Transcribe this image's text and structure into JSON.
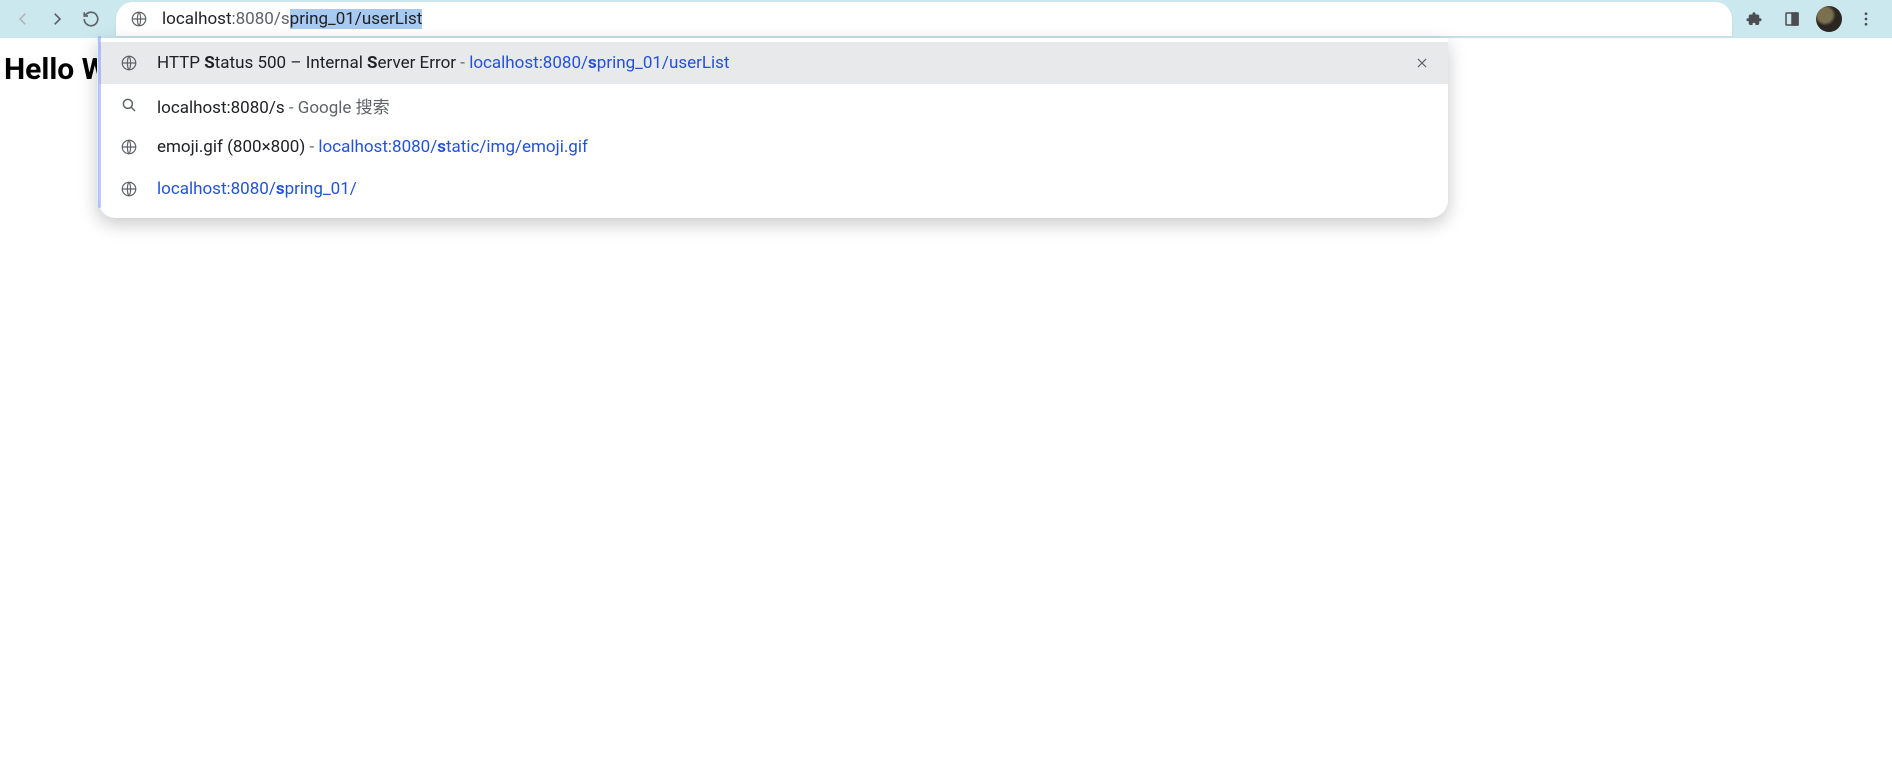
{
  "toolbar": {
    "url_host": "localhost",
    "url_port": ":8080",
    "url_typed": "/s",
    "url_completed": "pring_01/userList"
  },
  "page": {
    "heading_visible": "Hello W"
  },
  "suggestions": [
    {
      "icon": "globe",
      "title_pre": "HTTP ",
      "title_b1": "S",
      "title_mid1": "tatus 500 – Internal ",
      "title_b2": "S",
      "title_mid2": "erver Error",
      "sep": " - ",
      "url_pre": "localhost:8080/",
      "url_b": "s",
      "url_post": "pring_01/userList",
      "removable": true,
      "selected": true
    },
    {
      "icon": "search",
      "title_pre": "localhost:8080/s",
      "sep": " - ",
      "muted": "Google 搜索",
      "removable": false,
      "selected": false
    },
    {
      "icon": "globe",
      "title_pre": "emoji.gif (800×800)",
      "sep": " - ",
      "url_pre": "localhost:8080/",
      "url_b": "s",
      "url_post": "tatic/img/emoji.gif",
      "removable": false,
      "selected": false
    },
    {
      "icon": "globe",
      "url_pre": "localhost:8080/",
      "url_b": "s",
      "url_post": "pring_01/",
      "removable": false,
      "selected": false
    }
  ]
}
